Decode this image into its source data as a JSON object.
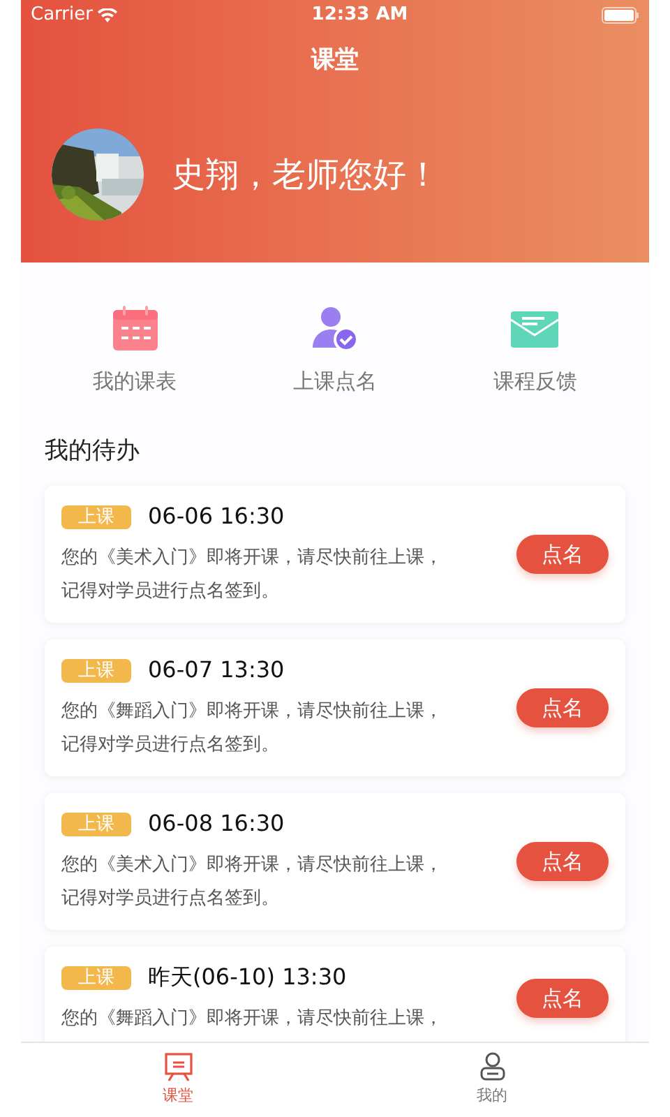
{
  "status_bar": {
    "carrier": "Carrier",
    "time": "12:33 AM"
  },
  "header": {
    "title": "课堂",
    "greeting": "史翔，老师您好！"
  },
  "shortcuts": [
    {
      "kind": "calendar",
      "label": "我的课表"
    },
    {
      "kind": "roll_call",
      "label": "上课点名"
    },
    {
      "kind": "feedback",
      "label": "课程反馈"
    }
  ],
  "todo": {
    "title": "我的待办",
    "items": [
      {
        "tag": "上课",
        "time": "06-06 16:30",
        "lines": [
          "您的《美术入门》即将开课，请尽快前往上课，",
          "记得对学员进行点名签到。"
        ],
        "action": "点名"
      },
      {
        "tag": "上课",
        "time": "06-07 13:30",
        "lines": [
          "您的《舞蹈入门》即将开课，请尽快前往上课，",
          "记得对学员进行点名签到。"
        ],
        "action": "点名"
      },
      {
        "tag": "上课",
        "time": "06-08 16:30",
        "lines": [
          "您的《美术入门》即将开课，请尽快前往上课，",
          "记得对学员进行点名签到。"
        ],
        "action": "点名"
      },
      {
        "tag": "上课",
        "time": "昨天(06-10) 13:30",
        "lines": [
          "您的《舞蹈入门》即将开课，请尽快前往上课，"
        ],
        "action": "点名"
      }
    ]
  },
  "tab_bar": [
    {
      "kind": "classroom",
      "label": "课堂",
      "selected": true
    },
    {
      "kind": "profile",
      "label": "我的",
      "selected": false
    }
  ]
}
